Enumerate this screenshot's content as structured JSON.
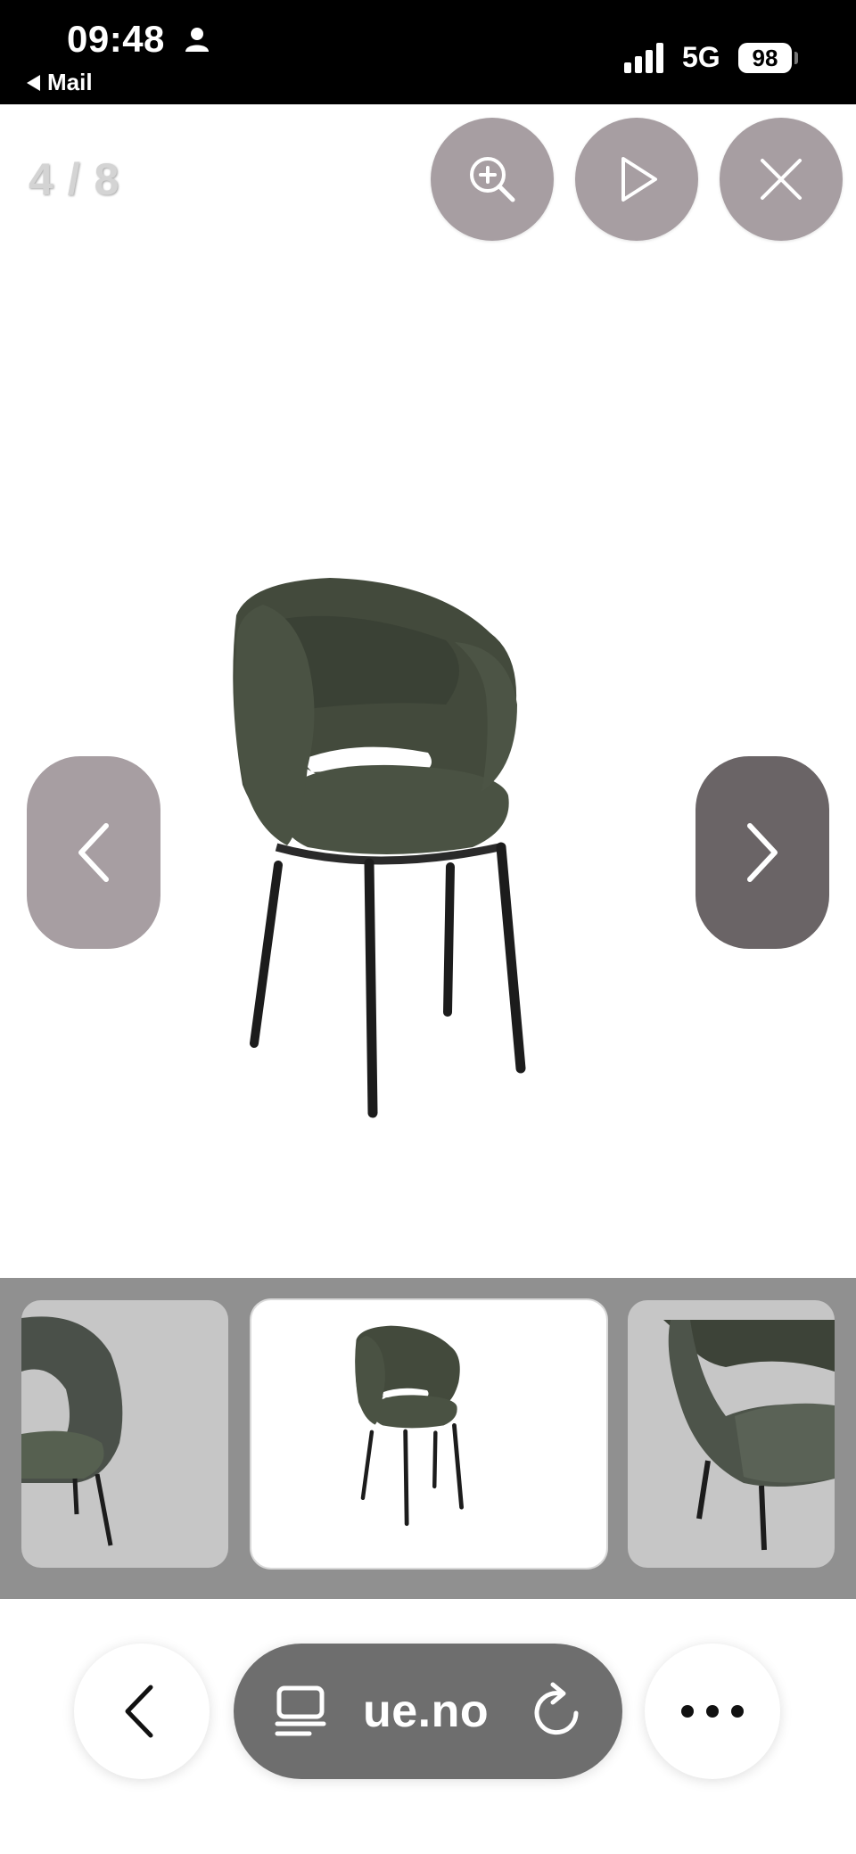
{
  "status_bar": {
    "time": "09:48",
    "back_app": "Mail",
    "network": "5G",
    "battery": "98"
  },
  "viewer": {
    "counter": "4 / 8",
    "buttons": {
      "zoom": "zoom-in-icon",
      "slideshow": "play-icon",
      "close": "close-icon",
      "previous": "chevron-left-icon",
      "next": "chevron-right-icon"
    }
  },
  "browser": {
    "url": "ue.no"
  },
  "colors": {
    "overlay_button": "#a79ea2",
    "next_button": "#6a6466",
    "thumb_strip": "#909090",
    "chair_fabric": "#3f4638",
    "chair_legs": "#1c1c1c"
  }
}
